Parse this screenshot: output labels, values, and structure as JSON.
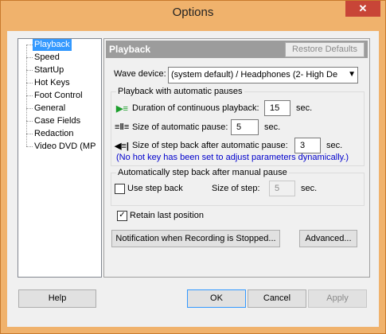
{
  "window": {
    "title": "Options",
    "close_glyph": "✕"
  },
  "tree": {
    "items": [
      "Playback",
      "Speed",
      "StartUp",
      "Hot Keys",
      "Foot Control",
      "General",
      "Case Fields",
      "Redaction",
      "Video DVD (MP"
    ]
  },
  "panel": {
    "title": "Playback",
    "restore_label": "Restore Defaults",
    "wave_label": "Wave device:",
    "wave_value": "(system default)  /  Headphones (2- High De",
    "group1": {
      "title": "Playback with automatic pauses",
      "row1_label": "Duration of continuous playback:",
      "row1_value": "15",
      "row1_unit": "sec.",
      "row2_label": "Size of automatic pause:",
      "row2_value": "5",
      "row2_unit": "sec.",
      "row3_label": "Size of step back after automatic pause:",
      "row3_value": "3",
      "row3_unit": "sec.",
      "note": "(No hot key has been set to adjust parameters dynamically.)"
    },
    "group2": {
      "title": "Automatically step back after manual pause",
      "use_step_back_label": "Use step back",
      "size_label": "Size of step:",
      "size_value": "5",
      "size_unit": "sec."
    },
    "retain_label": "Retain last position",
    "notification_btn": "Notification when Recording is Stopped...",
    "advanced_btn": "Advanced..."
  },
  "footer": {
    "help": "Help",
    "ok": "OK",
    "cancel": "Cancel",
    "apply": "Apply"
  },
  "colors": {
    "title_bar": "#f0b26c",
    "selection": "#3399ff",
    "panel_header": "#9c9c9c",
    "note": "#0000cc"
  }
}
